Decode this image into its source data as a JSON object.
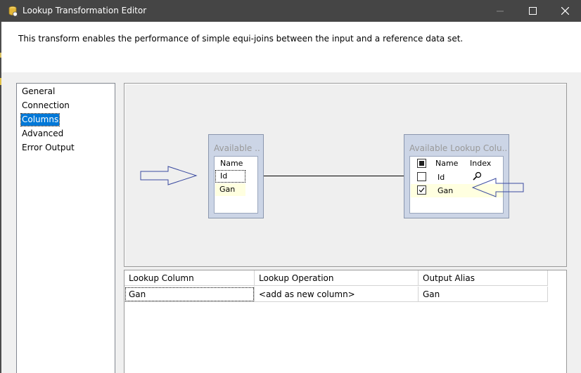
{
  "window": {
    "title": "Lookup Transformation Editor",
    "description": "This transform enables the performance of simple equi-joins between the input and a reference data set."
  },
  "nav": {
    "items": [
      "General",
      "Connection",
      "Columns",
      "Advanced",
      "Error Output"
    ],
    "selected": "Columns"
  },
  "diagram": {
    "input_table": {
      "caption": "Available ...",
      "header": "Name",
      "rows": [
        "Id",
        "Gan"
      ]
    },
    "lookup_table": {
      "caption": "Available Lookup Colu...",
      "headers": [
        "Name",
        "Index"
      ],
      "rows": [
        {
          "name": "Id",
          "checked": false,
          "index_icon": "magnifier-icon"
        },
        {
          "name": "Gan",
          "checked": true,
          "index_icon": ""
        }
      ]
    }
  },
  "lookup_grid": {
    "headers": [
      "Lookup Column",
      "Lookup Operation",
      "Output Alias"
    ],
    "rows": [
      {
        "lookup_column": "Gan",
        "lookup_operation": "<add as new column>",
        "output_alias": "Gan"
      }
    ]
  },
  "colors": {
    "titlebar": "#454545",
    "selection": "#0078d7",
    "table_frame": "#ccd5e6",
    "row_highlight": "#ffffe0",
    "annotation_arrow": "#3b4ba0"
  }
}
